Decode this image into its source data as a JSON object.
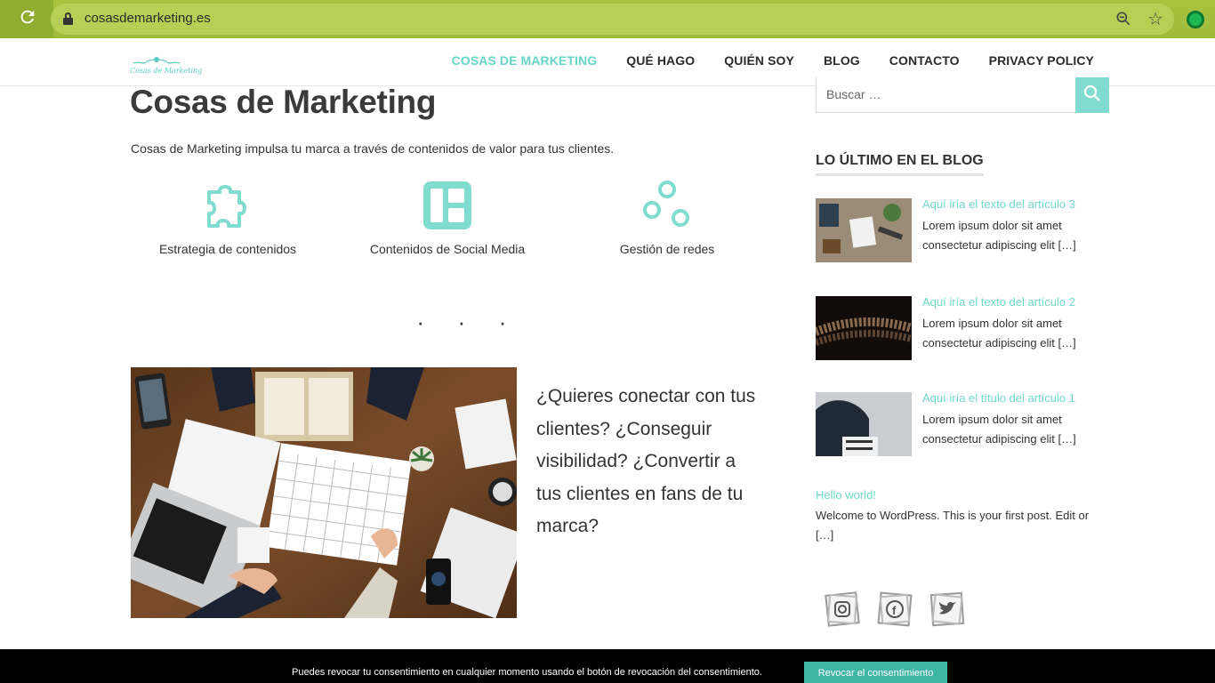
{
  "browser": {
    "url": "cosasdemarketing.es"
  },
  "header": {
    "logo_text": "Cosas de Marketing",
    "nav": [
      {
        "label": "COSAS DE MARKETING",
        "active": true
      },
      {
        "label": "QUÉ HAGO",
        "active": false
      },
      {
        "label": "QUIÉN SOY",
        "active": false
      },
      {
        "label": "BLOG",
        "active": false
      },
      {
        "label": "CONTACTO",
        "active": false
      },
      {
        "label": "PRIVACY POLICY",
        "active": false
      }
    ]
  },
  "main": {
    "title": "Cosas de Marketing",
    "intro": "Cosas de Marketing impulsa tu marca a través de contenidos de valor para tus clientes.",
    "services": [
      {
        "icon": "puzzle-icon",
        "label": "Estrategia de contenidos"
      },
      {
        "icon": "layout-icon",
        "label": "Contenidos de Social Media"
      },
      {
        "icon": "network-icon",
        "label": "Gestión de redes"
      }
    ],
    "dots": "· · ·",
    "question": "¿Quieres conectar con tus clientes? ¿Conseguir visibilidad? ¿Convertir a tus clientes en fans de tu marca?"
  },
  "sidebar": {
    "search_placeholder": "Buscar …",
    "widget_title": "LO ÚLTIMO EN EL BLOG",
    "posts": [
      {
        "title": "Aquí iría el texto del artículo 3",
        "excerpt": "Lorem ipsum dolor sit amet consectetur adipiscing elit […]"
      },
      {
        "title": "Aquí iría el texto del artículo 2",
        "excerpt": "Lorem ipsum dolor sit amet consectetur adipiscing elit […]"
      },
      {
        "title": "Aquí iría el título del artículo 1",
        "excerpt": "Lorem ipsum dolor sit amet consectetur adipiscing elit […]"
      }
    ],
    "hello_title": "Hello world!",
    "hello_text": "Welcome to WordPress. This is your first post. Edit or […]",
    "social": [
      "instagram-icon",
      "facebook-icon",
      "twitter-icon"
    ]
  },
  "cookie": {
    "text": "Puedes revocar tu consentimiento en cualquier momento usando el botón de revocación del consentimiento.",
    "button": "Revocar el consentimiento"
  },
  "colors": {
    "accent": "#67d6c8",
    "browser": "#a9c23f",
    "cookie_button": "#3fb5a5"
  }
}
